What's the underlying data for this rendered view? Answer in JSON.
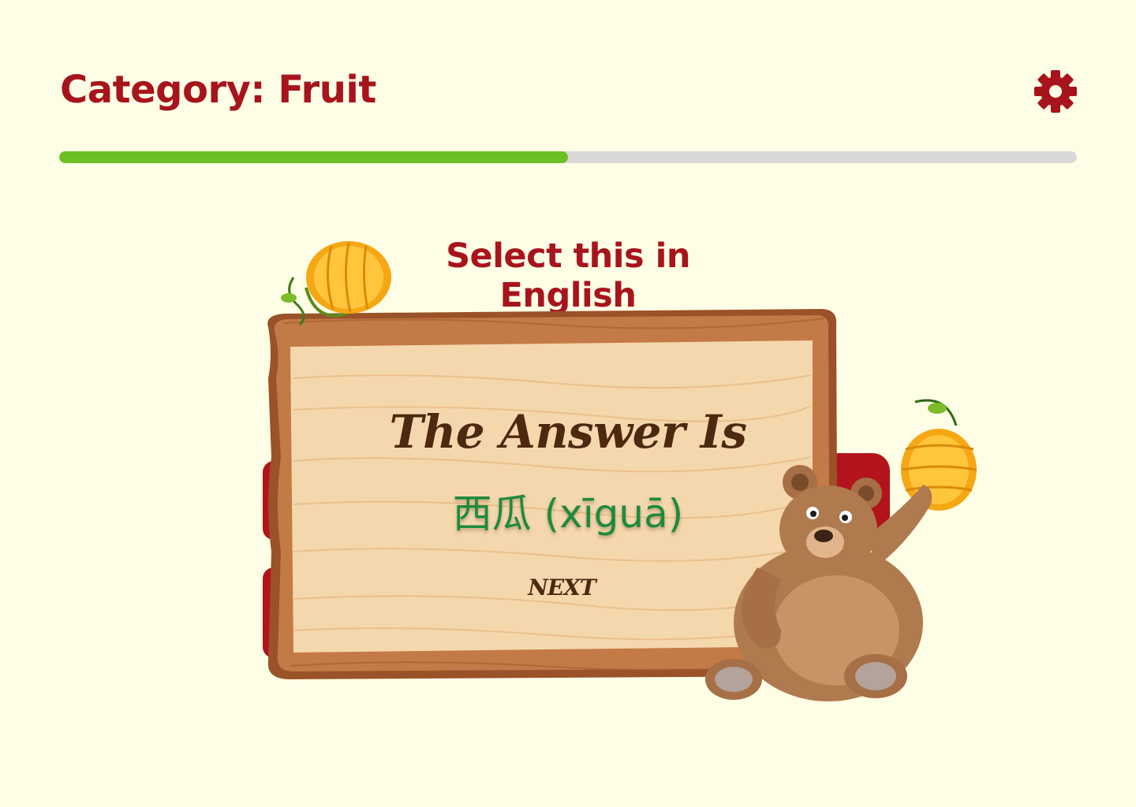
{
  "header": {
    "title": "Category: Fruit",
    "settings_icon": "gear-icon"
  },
  "progress": {
    "fraction": 0.5
  },
  "prompt": {
    "instruction": "Select this in English"
  },
  "answer_card": {
    "heading": "The Answer Is",
    "word": "西瓜 (xīguā)",
    "next_label": "NEXT"
  },
  "colors": {
    "background": "#fefee6",
    "accent": "#a8141b",
    "progress_fill": "#6cbf25",
    "progress_track": "#d9d9d9",
    "answer_text": "#1e8a3e",
    "wood_text": "#4f2810"
  },
  "decorations": [
    "honeycomb-icon",
    "bear-mascot",
    "wooden-sign"
  ]
}
